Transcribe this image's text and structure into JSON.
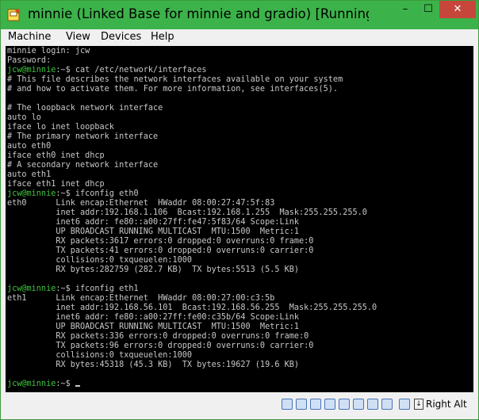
{
  "window": {
    "title": "minnie (Linked Base for minnie and gradio) [Running] - ...",
    "minimize_glyph": "–",
    "maximize_glyph": "☐",
    "close_glyph": "✕",
    "titlebar_color": "#3cb34a",
    "close_color": "#c7463b"
  },
  "menu": [
    "Machine",
    "View",
    "Devices",
    "Help"
  ],
  "terminal": {
    "prompt_color": "#3ec43e",
    "text_color": "#c8c8c8",
    "lines": [
      {
        "prompt": "",
        "text": "minnie login: jcw"
      },
      {
        "prompt": "",
        "text": "Password:"
      },
      {
        "prompt": "jcw@minnie",
        "text": ":~$ cat /etc/network/interfaces"
      },
      {
        "prompt": "",
        "text": "# This file describes the network interfaces available on your system"
      },
      {
        "prompt": "",
        "text": "# and how to activate them. For more information, see interfaces(5)."
      },
      {
        "prompt": "",
        "text": ""
      },
      {
        "prompt": "",
        "text": "# The loopback network interface"
      },
      {
        "prompt": "",
        "text": "auto lo"
      },
      {
        "prompt": "",
        "text": "iface lo inet loopback"
      },
      {
        "prompt": "",
        "text": "# The primary network interface"
      },
      {
        "prompt": "",
        "text": "auto eth0"
      },
      {
        "prompt": "",
        "text": "iface eth0 inet dhcp"
      },
      {
        "prompt": "",
        "text": "# A secondary network interface"
      },
      {
        "prompt": "",
        "text": "auto eth1"
      },
      {
        "prompt": "",
        "text": "iface eth1 inet dhcp"
      },
      {
        "prompt": "jcw@minnie",
        "text": ":~$ ifconfig eth0"
      },
      {
        "prompt": "",
        "text": "eth0      Link encap:Ethernet  HWaddr 08:00:27:47:5f:83"
      },
      {
        "prompt": "",
        "text": "          inet addr:192.168.1.106  Bcast:192.168.1.255  Mask:255.255.255.0"
      },
      {
        "prompt": "",
        "text": "          inet6 addr: fe80::a00:27ff:fe47:5f83/64 Scope:Link"
      },
      {
        "prompt": "",
        "text": "          UP BROADCAST RUNNING MULTICAST  MTU:1500  Metric:1"
      },
      {
        "prompt": "",
        "text": "          RX packets:3617 errors:0 dropped:0 overruns:0 frame:0"
      },
      {
        "prompt": "",
        "text": "          TX packets:41 errors:0 dropped:0 overruns:0 carrier:0"
      },
      {
        "prompt": "",
        "text": "          collisions:0 txqueuelen:1000"
      },
      {
        "prompt": "",
        "text": "          RX bytes:282759 (282.7 KB)  TX bytes:5513 (5.5 KB)"
      },
      {
        "prompt": "",
        "text": ""
      },
      {
        "prompt": "jcw@minnie",
        "text": ":~$ ifconfig eth1"
      },
      {
        "prompt": "",
        "text": "eth1      Link encap:Ethernet  HWaddr 08:00:27:00:c3:5b"
      },
      {
        "prompt": "",
        "text": "          inet addr:192.168.56.101  Bcast:192.168.56.255  Mask:255.255.255.0"
      },
      {
        "prompt": "",
        "text": "          inet6 addr: fe80::a00:27ff:fe00:c35b/64 Scope:Link"
      },
      {
        "prompt": "",
        "text": "          UP BROADCAST RUNNING MULTICAST  MTU:1500  Metric:1"
      },
      {
        "prompt": "",
        "text": "          RX packets:336 errors:0 dropped:0 overruns:0 frame:0"
      },
      {
        "prompt": "",
        "text": "          TX packets:96 errors:0 dropped:0 overruns:0 carrier:0"
      },
      {
        "prompt": "",
        "text": "          collisions:0 txqueuelen:1000"
      },
      {
        "prompt": "",
        "text": "          RX bytes:45318 (45.3 KB)  TX bytes:19627 (19.6 KB)"
      },
      {
        "prompt": "",
        "text": ""
      },
      {
        "prompt": "jcw@minnie",
        "text": ":~$ ",
        "cursor": true
      }
    ]
  },
  "statusbar": {
    "icons": [
      "hard-disk-icon",
      "optical-drive-icon",
      "usb-icon",
      "shared-folders-icon",
      "display-icon",
      "network-icon",
      "video-capture-icon",
      "virtualization-icon",
      "mouse-integration-icon"
    ],
    "host_key": "Right Alt"
  }
}
